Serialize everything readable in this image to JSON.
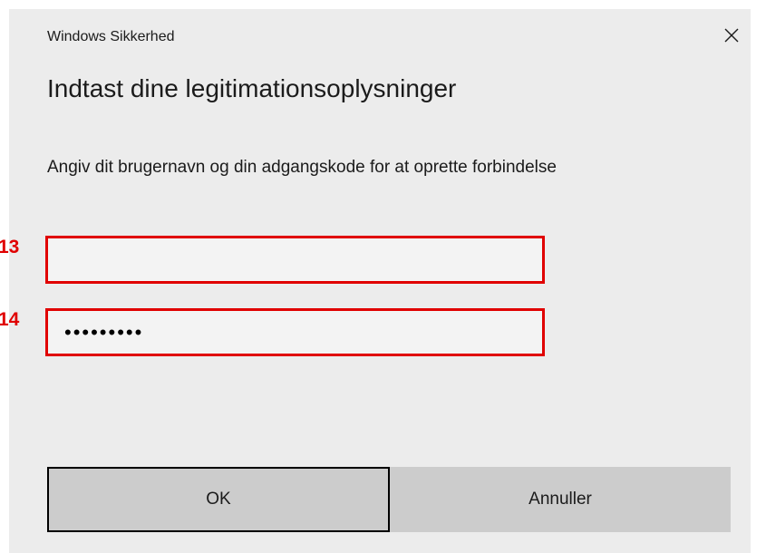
{
  "window": {
    "title": "Windows Sikkerhed",
    "close_icon": "close-icon"
  },
  "dialog": {
    "heading": "Indtast dine legitimationsoplysninger",
    "instructions": "Angiv dit brugernavn og din adgangskode for at oprette forbindelse"
  },
  "fields": {
    "username": {
      "value": "",
      "marker": "13"
    },
    "password": {
      "value": "•••••••••",
      "marker": "14"
    }
  },
  "buttons": {
    "ok_label": "OK",
    "cancel_label": "Annuller"
  },
  "colors": {
    "dialog_background": "#ececec",
    "field_background": "#f3f3f3",
    "highlight_border": "#e00000",
    "button_background": "#cccccc",
    "focused_button_border": "#000000"
  }
}
